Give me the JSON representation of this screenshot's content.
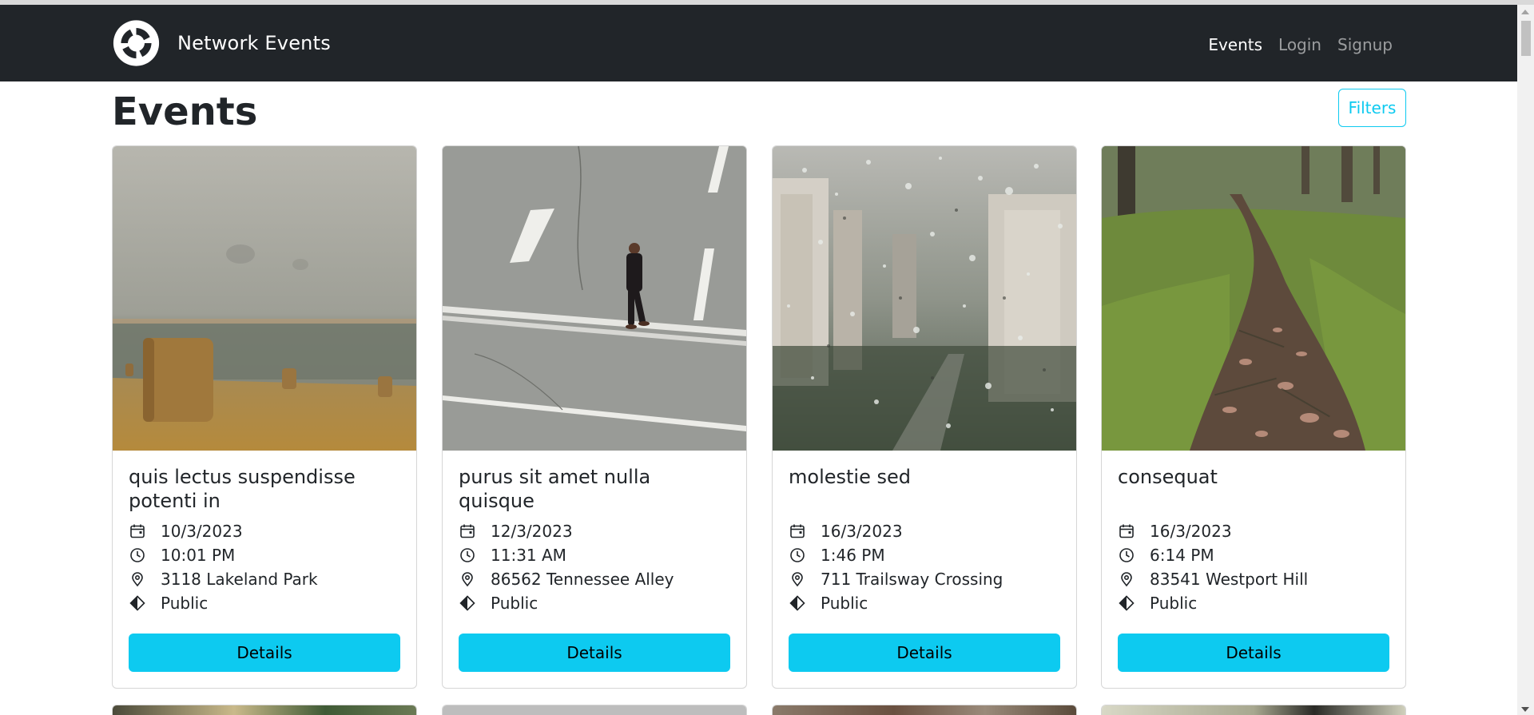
{
  "app": {
    "brand": "Network Events",
    "nav": [
      {
        "label": "Events",
        "active": true
      },
      {
        "label": "Login",
        "active": false
      },
      {
        "label": "Signup",
        "active": false
      }
    ]
  },
  "page": {
    "title": "Events",
    "filters_label": "Filters"
  },
  "events": [
    {
      "title": "quis lectus suspendisse potenti in",
      "date": "10/3/2023",
      "time": "10:01 PM",
      "location": "3118 Lakeland Park",
      "visibility": "Public",
      "button": "Details",
      "image": "hay-bales-field-photo"
    },
    {
      "title": "purus sit amet nulla quisque",
      "date": "12/3/2023",
      "time": "11:31 AM",
      "location": "86562 Tennessee Alley",
      "visibility": "Public",
      "button": "Details",
      "image": "man-walking-road-photo"
    },
    {
      "title": "molestie sed",
      "date": "16/3/2023",
      "time": "1:46 PM",
      "location": "711 Trailsway Crossing",
      "visibility": "Public",
      "button": "Details",
      "image": "rainy-window-city-photo"
    },
    {
      "title": "consequat",
      "date": "16/3/2023",
      "time": "6:14 PM",
      "location": "83541 Westport Hill",
      "visibility": "Public",
      "button": "Details",
      "image": "forest-path-photo"
    }
  ],
  "colors": {
    "navbar": "#212529",
    "accent": "#0dcaf0",
    "text": "#212529"
  }
}
